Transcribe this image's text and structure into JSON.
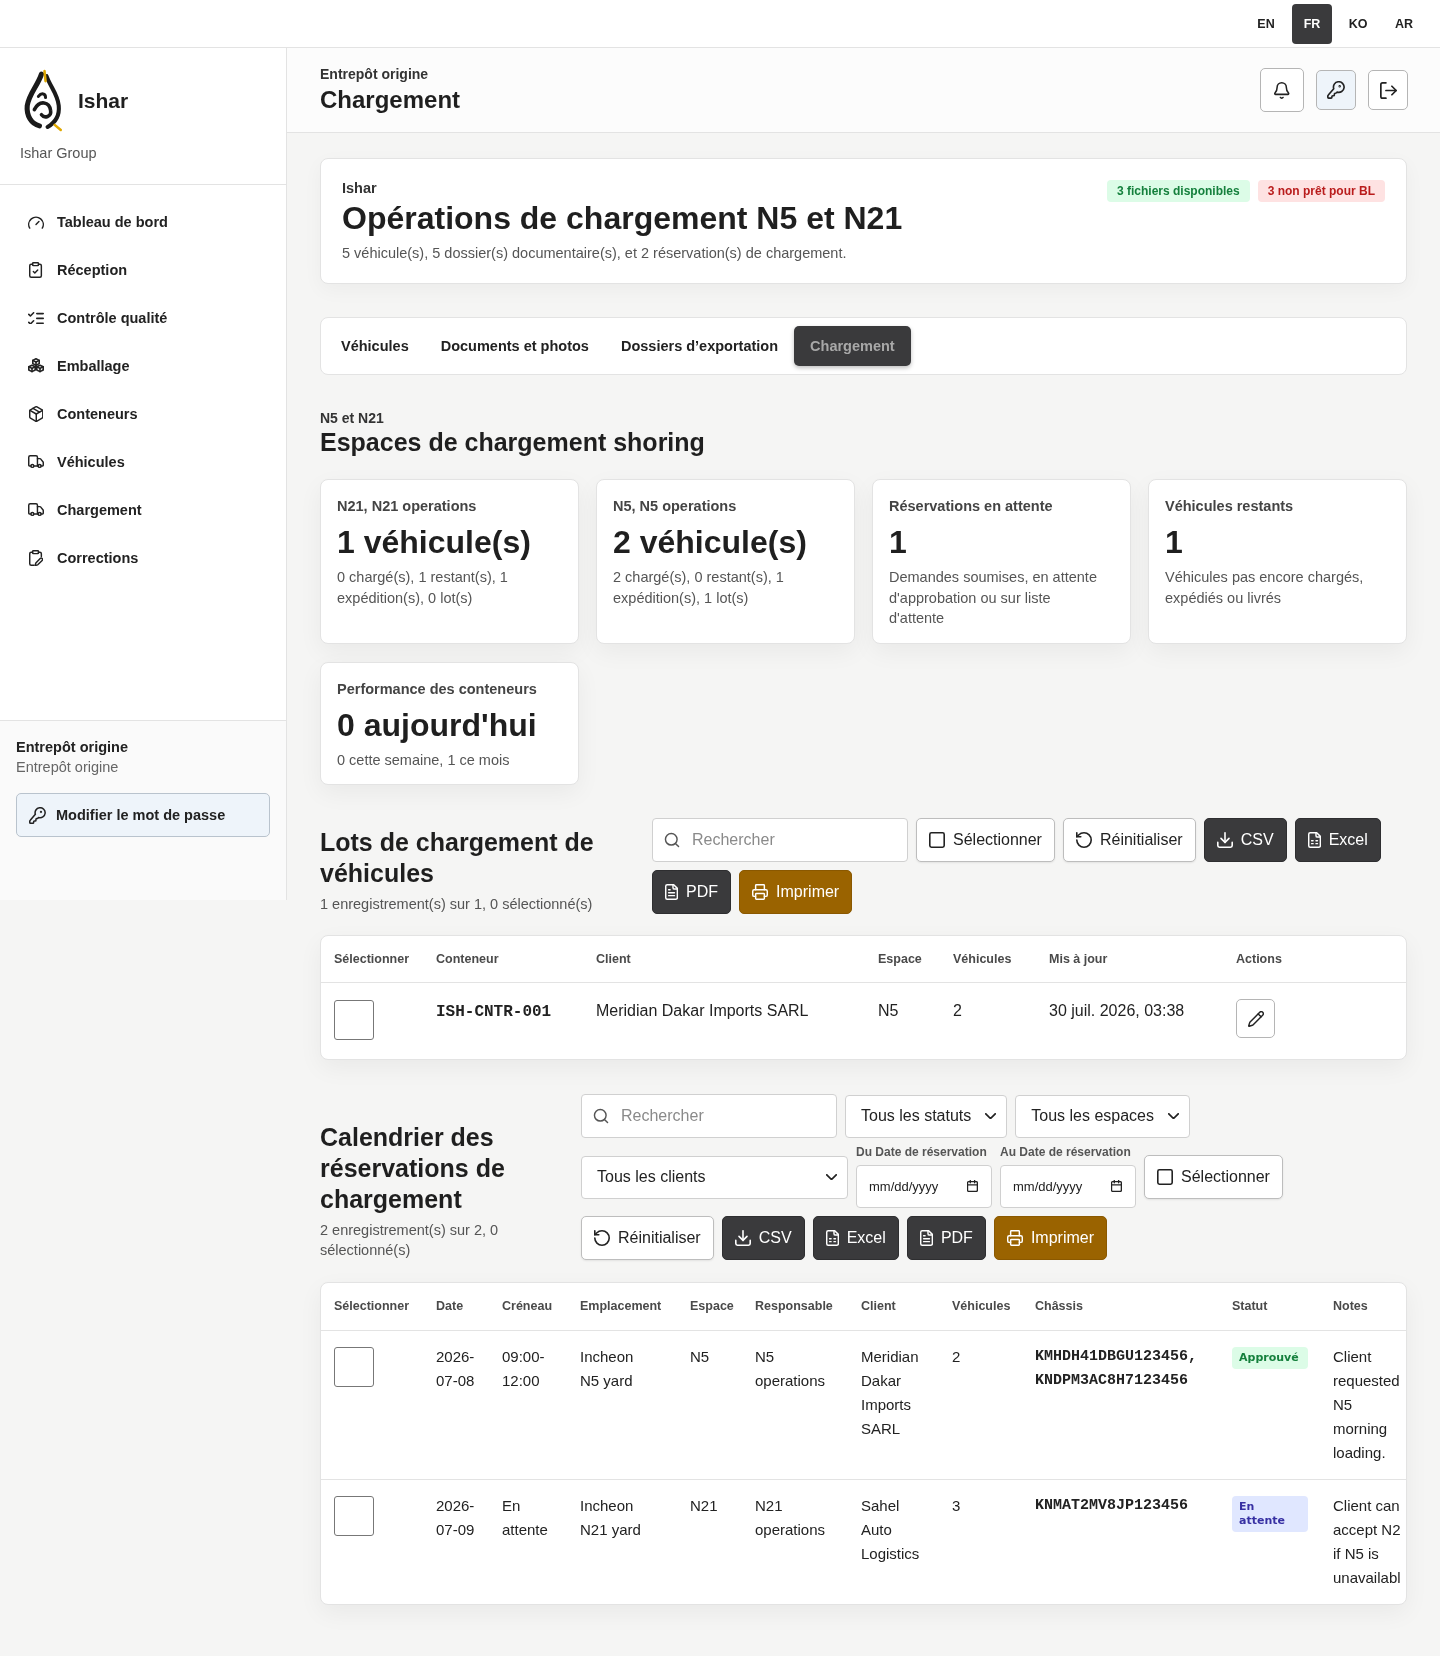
{
  "languages": [
    {
      "label": "EN",
      "selected": false
    },
    {
      "label": "FR",
      "selected": true
    },
    {
      "label": "KO",
      "selected": false
    },
    {
      "label": "AR",
      "selected": false
    }
  ],
  "sidebar": {
    "brand": "Ishar",
    "organization": "Ishar Group",
    "items": [
      {
        "label": "Tableau de bord"
      },
      {
        "label": "Réception"
      },
      {
        "label": "Contrôle qualité"
      },
      {
        "label": "Emballage"
      },
      {
        "label": "Conteneurs"
      },
      {
        "label": "Véhicules"
      },
      {
        "label": "Chargement"
      },
      {
        "label": "Corrections"
      }
    ],
    "user": {
      "name": "Entrepôt origine",
      "role": "Entrepôt origine"
    },
    "password_button": "Modifier le mot de passe"
  },
  "header": {
    "eyebrow": "Entrepôt origine",
    "title": "Chargement"
  },
  "summary": {
    "eyebrow": "Ishar",
    "title": "Opérations de chargement N5 et N21",
    "description": "5 véhicule(s), 5 dossier(s) documentaire(s), et 2 réservation(s) de chargement.",
    "badges": [
      {
        "label": "3 fichiers disponibles",
        "kind": "success"
      },
      {
        "label": "3 non prêt pour BL",
        "kind": "danger"
      }
    ]
  },
  "tabs": [
    {
      "label": "Véhicules",
      "selected": false
    },
    {
      "label": "Documents et photos",
      "selected": false
    },
    {
      "label": "Dossiers d’exportation",
      "selected": false
    },
    {
      "label": "Chargement",
      "selected": true
    }
  ],
  "spaces": {
    "eyebrow": "N5 et N21",
    "title": "Espaces de chargement shoring",
    "cards": [
      {
        "label": "N21, N21 operations",
        "value": "1 véhicule(s)",
        "detail": "0 chargé(s), 1 restant(s), 1 expédition(s), 0 lot(s)"
      },
      {
        "label": "N5, N5 operations",
        "value": "2 véhicule(s)",
        "detail": "2 chargé(s), 0 restant(s), 1 expédition(s), 1 lot(s)"
      },
      {
        "label": "Réservations en attente",
        "value": "1",
        "detail": "Demandes soumises, en attente d'approbation ou sur liste d'attente"
      },
      {
        "label": "Véhicules restants",
        "value": "1",
        "detail": "Véhicules pas encore chargés, expédiés ou livrés"
      },
      {
        "label": "Performance des conteneurs",
        "value": "0 aujourd'hui",
        "detail": "0 cette semaine, 1 ce mois"
      }
    ]
  },
  "lots": {
    "title": "Lots de chargement de véhicules",
    "summary": "1 enregistrement(s) sur 1, 0 sélectionné(s)",
    "controls": [
      {
        "kind": "search",
        "placeholder": "Rechercher"
      },
      {
        "kind": "select",
        "label": "Sélectionner"
      },
      {
        "kind": "reset",
        "label": "Réinitialiser"
      },
      {
        "kind": "csv",
        "label": "CSV"
      },
      {
        "kind": "excel",
        "label": "Excel"
      },
      {
        "kind": "pdf",
        "label": "PDF"
      },
      {
        "kind": "print",
        "label": "Imprimer"
      }
    ],
    "table": {
      "columns": [
        "Sélectionner",
        "Conteneur",
        "Client",
        "Espace",
        "Véhicules",
        "Mis à jour",
        "Actions"
      ],
      "rows": [
        {
          "checked": false,
          "container": "ISH-CNTR-001",
          "client": "Meridian Dakar Imports SARL",
          "space": "N5",
          "vehicles": "2",
          "updated": "30 juil. 2026, 03:38"
        }
      ]
    }
  },
  "calendar": {
    "title": "Calendrier des réservations de chargement",
    "summary": "2 enregistrement(s) sur 2, 0 sélectionné(s)",
    "controls": [
      {
        "kind": "search",
        "placeholder": "Rechercher"
      },
      {
        "kind": "dropdown",
        "value": "Tous les statuts"
      },
      {
        "kind": "dropdown",
        "value": "Tous les espaces"
      },
      {
        "kind": "dropdown",
        "value": "Tous les clients"
      },
      {
        "kind": "date",
        "label": "Du Date de réservation",
        "placeholder": "mm/dd/yyyy"
      },
      {
        "kind": "date",
        "label": "Au Date de réservation",
        "placeholder": "mm/dd/yyyy"
      },
      {
        "kind": "select",
        "label": "Sélectionner"
      },
      {
        "kind": "reset",
        "label": "Réinitialiser"
      },
      {
        "kind": "csv",
        "label": "CSV"
      },
      {
        "kind": "excel",
        "label": "Excel"
      },
      {
        "kind": "pdf",
        "label": "PDF"
      },
      {
        "kind": "print",
        "label": "Imprimer"
      }
    ],
    "table": {
      "columns": [
        "Sélectionner",
        "Date",
        "Créneau",
        "Emplacement",
        "Espace",
        "Responsable",
        "Client",
        "Véhicules",
        "Châssis",
        "Statut",
        "Notes"
      ],
      "rows": [
        {
          "checked": false,
          "date": "2026-07-08",
          "slot": "09:00-12:00",
          "location": "Incheon N5 yard",
          "space": "N5",
          "owner": "N5 operations",
          "client": "Meridian Dakar Imports SARL",
          "vehicles": "2",
          "chassis": "KMHDH41DBGU123456, KNDPM3AC8H7123456",
          "status": {
            "label": "Approuvé",
            "kind": "success"
          },
          "notes": "Client requested N5 morning loading."
        },
        {
          "checked": false,
          "date": "2026-07-09",
          "slot": "En attente",
          "location": "Incheon N21 yard",
          "space": "N21",
          "owner": "N21 operations",
          "client": "Sahel Auto Logistics",
          "vehicles": "3",
          "chassis": "KNMAT2MV8JP123456",
          "status": {
            "label": "En attente",
            "kind": "info"
          },
          "notes": "Client can accept N2 if N5 is unavailabl"
        }
      ]
    }
  }
}
